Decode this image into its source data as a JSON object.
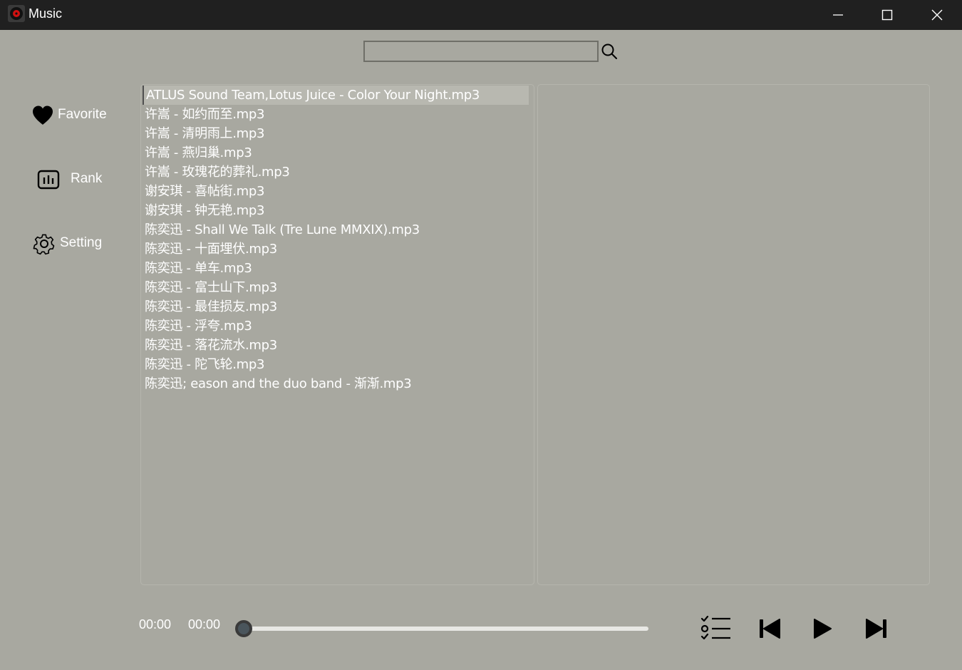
{
  "window": {
    "title": "Music"
  },
  "search": {
    "placeholder": "",
    "value": ""
  },
  "nav": [
    {
      "label": "Favorite",
      "icon": "heart-icon"
    },
    {
      "label": "Rank",
      "icon": "bar-chart-icon"
    },
    {
      "label": "Setting",
      "icon": "gear-icon"
    }
  ],
  "songs": [
    "ATLUS Sound Team,Lotus Juice - Color Your Night.mp3",
    "许嵩 - 如约而至.mp3",
    "许嵩 - 清明雨上.mp3",
    "许嵩 - 燕归巢.mp3",
    "许嵩 - 玫瑰花的葬礼.mp3",
    "谢安琪 - 喜帖街.mp3",
    "谢安琪 - 钟无艳.mp3",
    "陈奕迅 - Shall We Talk (Tre Lune MMXIX).mp3",
    "陈奕迅 - 十面埋伏.mp3",
    "陈奕迅 - 单车.mp3",
    "陈奕迅 - 富士山下.mp3",
    "陈奕迅 - 最佳损友.mp3",
    "陈奕迅 - 浮夸.mp3",
    "陈奕迅 - 落花流水.mp3",
    "陈奕迅 - 陀飞轮.mp3",
    "陈奕迅; eason and the duo band - 渐渐.mp3"
  ],
  "selected_index": 0,
  "player": {
    "current_time": "00:00",
    "total_time": "00:00",
    "progress": 0
  },
  "colors": {
    "background": "#a8a8a0",
    "titlebar": "#202020",
    "text": "#ffffff"
  }
}
